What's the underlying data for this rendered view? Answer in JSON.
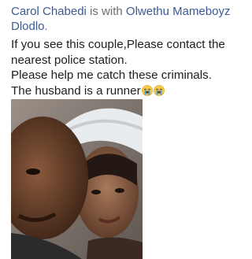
{
  "post": {
    "author": "Carol Chabedi",
    "with_text": " is with ",
    "tagged_user": "Olwethu Mameboyz Dlodlo",
    "tagged_suffix": ".",
    "body_lines": [
      "If you see this couple,Please contact the",
      "nearest police station.",
      "Please help me catch these criminals.",
      "The husband is a runner"
    ],
    "emojis": [
      "crying-face-icon",
      "crying-face-icon"
    ],
    "colors": {
      "link": "#3b5a94",
      "meta_text": "#6b6f76",
      "body_text": "#1c1e21"
    }
  }
}
